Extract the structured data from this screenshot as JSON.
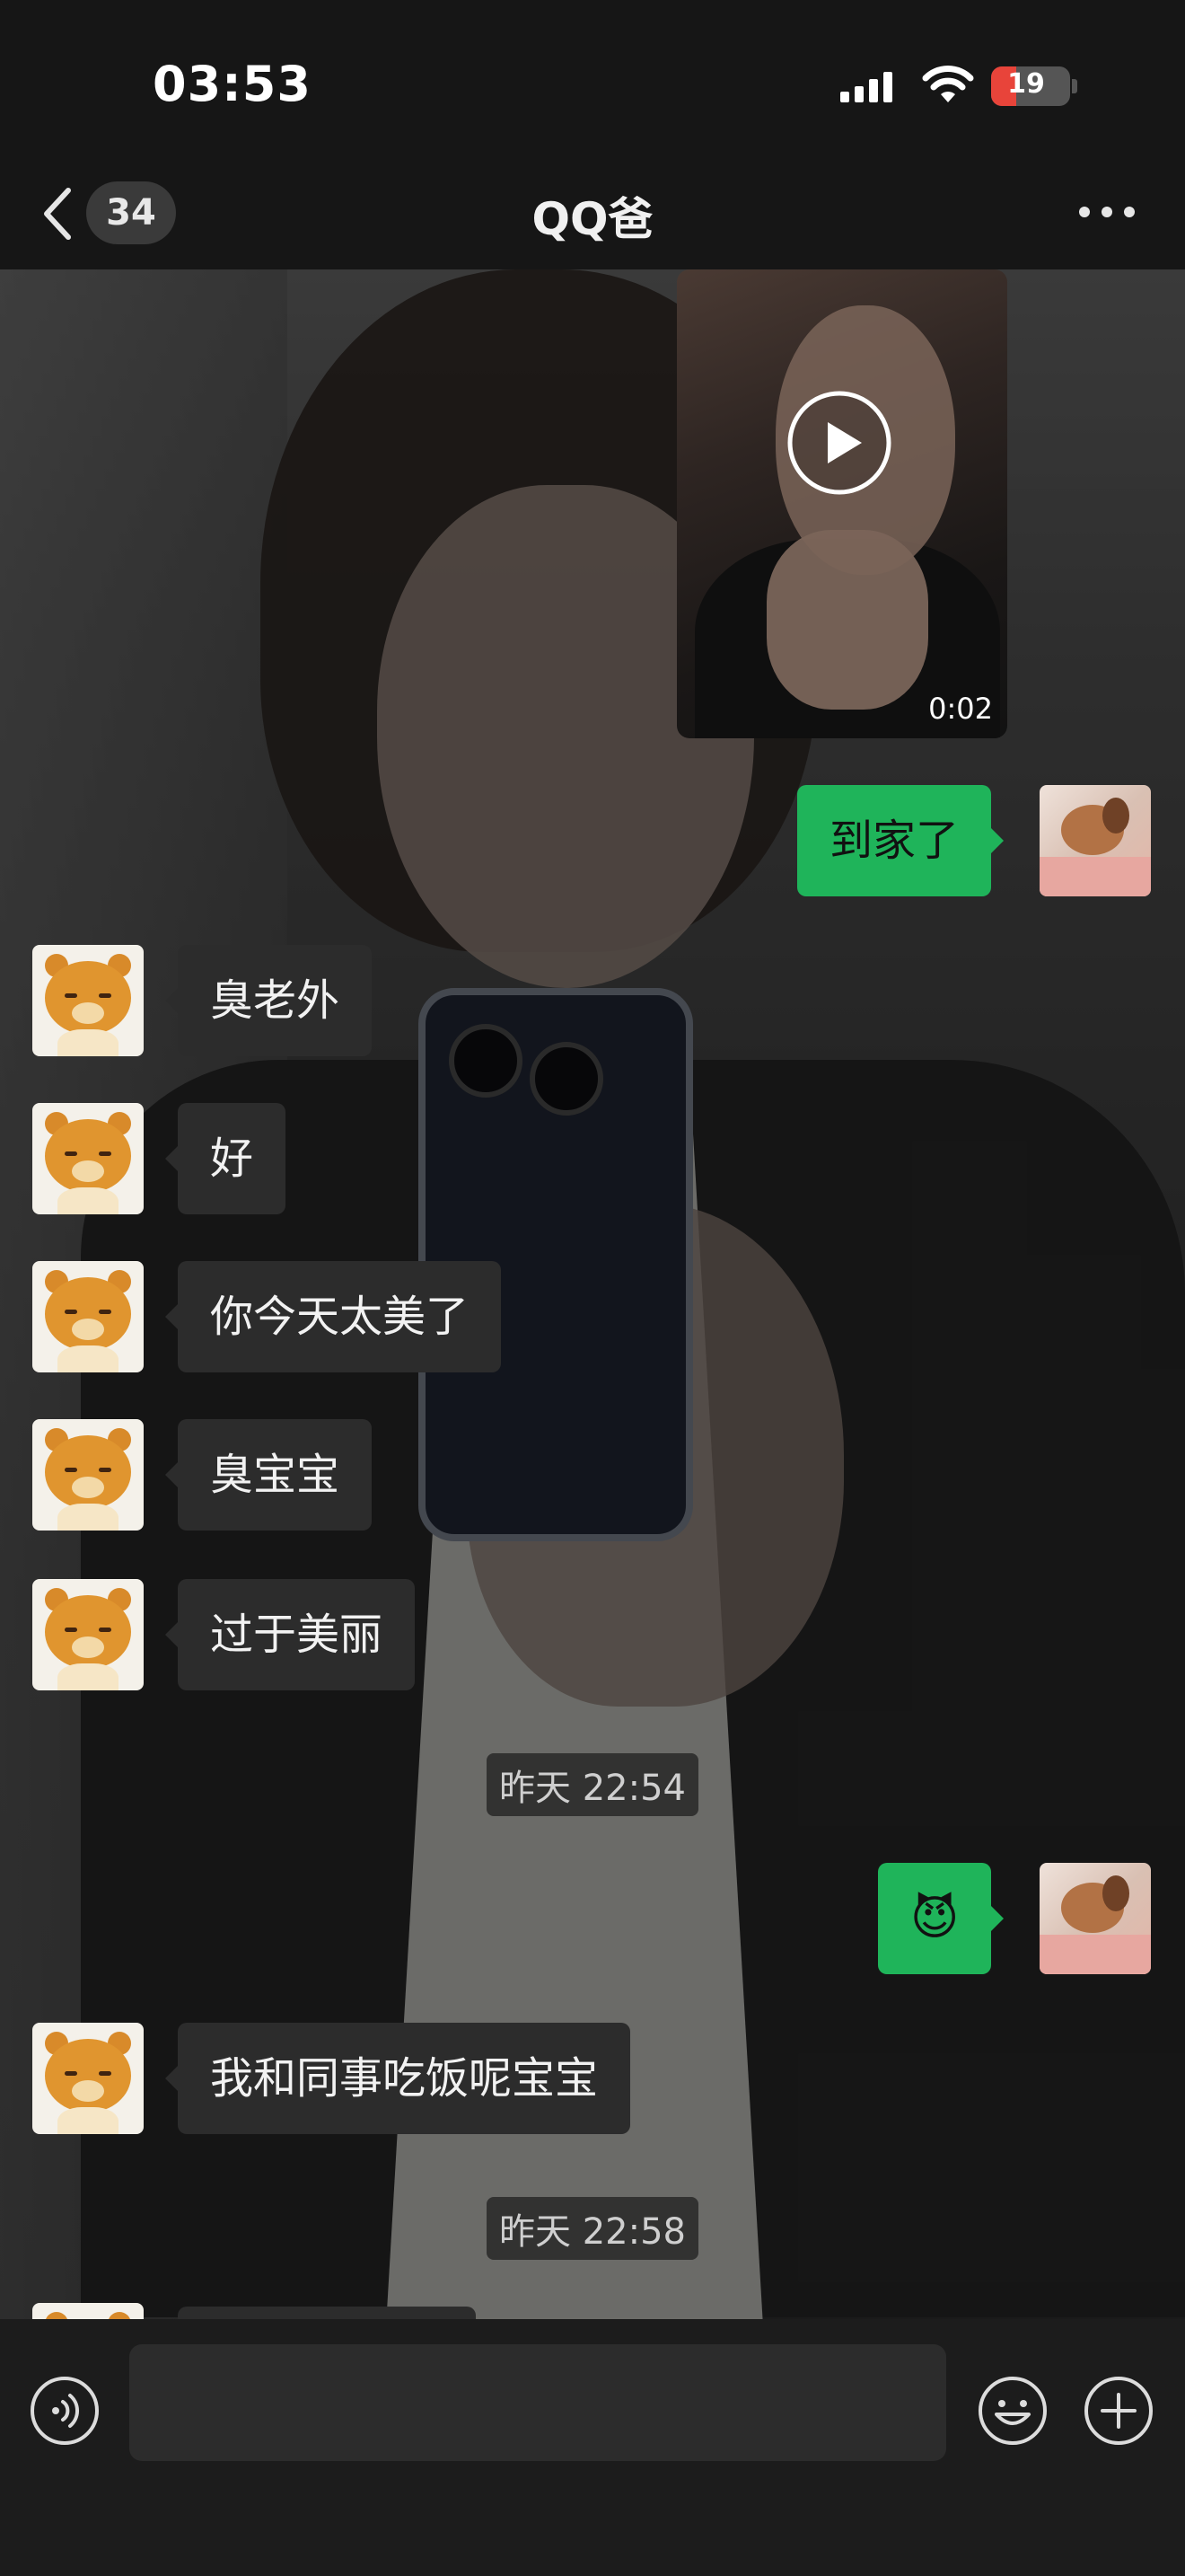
{
  "status_bar": {
    "time": "03:53",
    "battery": "19"
  },
  "nav": {
    "unread_count": "34",
    "title": "QQ爸"
  },
  "video_message": {
    "duration": "0:02"
  },
  "messages": [
    {
      "side": "out",
      "text": "到家了"
    },
    {
      "side": "in",
      "text": "臭老外"
    },
    {
      "side": "in",
      "text": "好"
    },
    {
      "side": "in",
      "text": "你今天太美了"
    },
    {
      "side": "in",
      "text": "臭宝宝"
    },
    {
      "side": "in",
      "text": "过于美丽"
    },
    {
      "side": "timestamp",
      "text": "昨天 22:54"
    },
    {
      "side": "out",
      "text": "😈"
    },
    {
      "side": "in",
      "text": "我和同事吃饭呢宝宝"
    },
    {
      "side": "timestamp",
      "text": "昨天 22:58"
    }
  ],
  "input": {
    "value": "",
    "placeholder": ""
  },
  "colors": {
    "outgoing_bubble": "#1fb45a",
    "incoming_bubble": "#2c2c2c",
    "battery_low": "#e8443a"
  }
}
